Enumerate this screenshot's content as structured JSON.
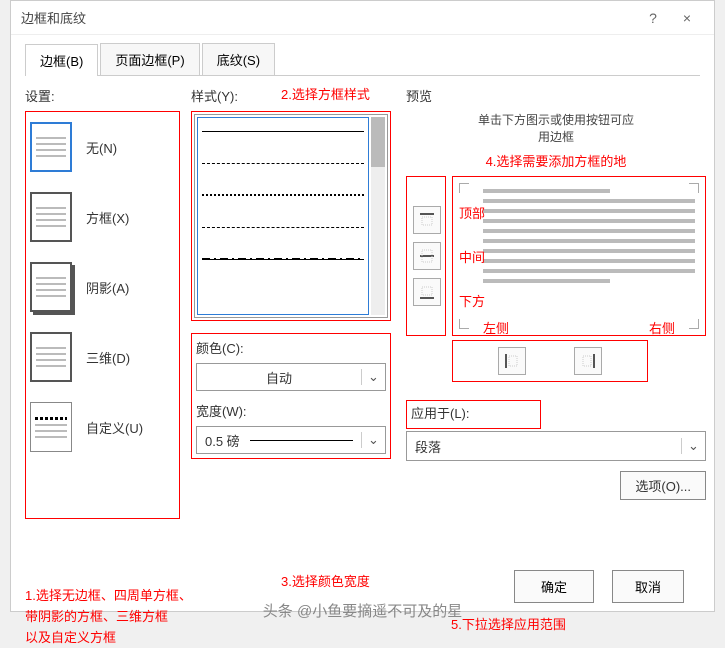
{
  "dialog": {
    "title": "边框和底纹",
    "help": "?",
    "close": "×"
  },
  "tabs": {
    "border": "边框(B)",
    "page_border": "页面边框(P)",
    "shading": "底纹(S)"
  },
  "left": {
    "settings_label": "设置:",
    "items": {
      "none": "无(N)",
      "box": "方框(X)",
      "shadow": "阴影(A)",
      "threeD": "三维(D)",
      "custom": "自定义(U)"
    }
  },
  "mid": {
    "style_label": "样式(Y):",
    "color_label": "颜色(C):",
    "color_value": "自动",
    "width_label": "宽度(W):",
    "width_value": "0.5 磅"
  },
  "right": {
    "preview_label": "预览",
    "preview_hint1": "单击下方图示或使用按钮可应",
    "preview_hint2": "用边框",
    "top": "顶部",
    "middle": "中间",
    "bottom": "下方",
    "left": "左侧",
    "right_side": "右侧",
    "apply_label": "应用于(L):",
    "apply_value": "段落",
    "options_btn": "选项(O)..."
  },
  "annot": {
    "a1": "1.选择无边框、四周单方框、带阴影的方框、三维方框以及自定义方框",
    "a1_line1": "1.选择无边框、四周单方框、",
    "a1_line2": "带阴影的方框、三维方框",
    "a1_line3": "以及自定义方框",
    "a2": "2.选择方框样式",
    "a3": "3.选择颜色宽度",
    "a4": "4.选择需要添加方框的地",
    "a5": "5.下拉选择应用范围"
  },
  "footer": {
    "ok": "确定",
    "cancel": "取消"
  },
  "watermark": "头条 @小鱼要摘遥不可及的星"
}
